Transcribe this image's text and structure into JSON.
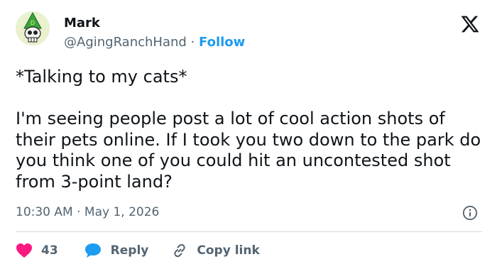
{
  "author": {
    "name": "Mark",
    "handle": "@AgingRanchHand",
    "separator": "·",
    "follow_label": "Follow"
  },
  "tweet": {
    "text": "*Talking to my cats*\n\nI'm seeing people post a lot of cool action shots of their pets online. If I took you two down to the park do you think one of you could hit an uncontested shot from 3-point land?",
    "timestamp": "10:30 AM · May 1, 2026"
  },
  "actions": {
    "likes_count": "43",
    "reply_label": "Reply",
    "copy_link_label": "Copy link"
  },
  "icons": {
    "logo": "x-logo-icon",
    "info": "info-icon",
    "heart": "heart-icon",
    "reply": "speech-bubble-icon",
    "link": "link-icon"
  },
  "colors": {
    "text": "#0f1419",
    "secondary": "#536471",
    "accent": "#1d9bf0",
    "like": "#f91880",
    "divider": "#cfd9de"
  }
}
